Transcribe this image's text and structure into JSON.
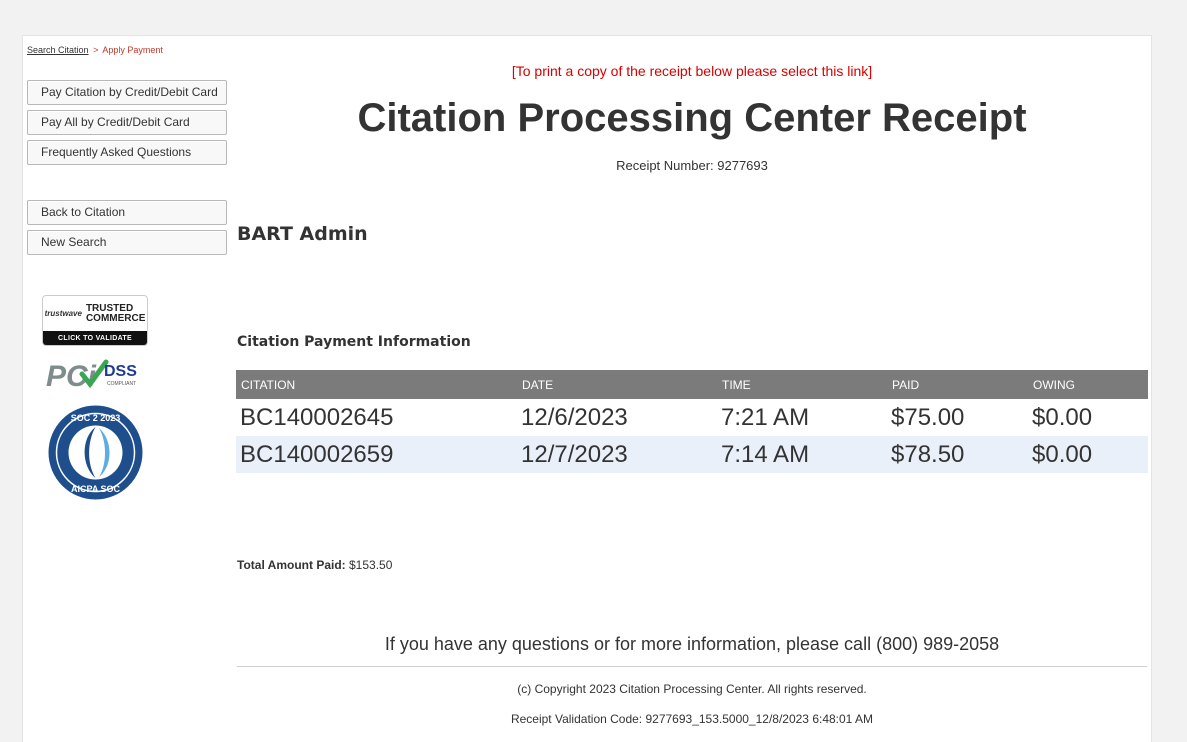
{
  "breadcrumb": {
    "link": "Search Citation",
    "separator": ">",
    "current": "Apply Payment"
  },
  "nav": {
    "pay_citation": "Pay Citation by Credit/Debit Card",
    "pay_all": "Pay All by Credit/Debit Card",
    "faq": "Frequently Asked Questions",
    "back": "Back to Citation",
    "new_search": "New Search"
  },
  "badges": {
    "trusted_logo": "trustwave",
    "trusted_line1": "TRUSTED",
    "trusted_line2": "COMMERCE",
    "trusted_click": "CLICK TO VALIDATE",
    "pci": "PCi",
    "dss": "DSS",
    "compliant": "COMPLIANT",
    "soc_top": "SOC 2 2023",
    "soc_bottom": "AICPA SOC"
  },
  "receipt": {
    "print_link": "[To print a copy of the receipt below please select this link]",
    "title": "Citation Processing Center Receipt",
    "number_label": "Receipt Number:",
    "number": "9277693",
    "account": "BART Admin",
    "section_title": "Citation Payment Information"
  },
  "table": {
    "headers": [
      "CITATION",
      "DATE",
      "TIME",
      "PAID",
      "OWING"
    ],
    "rows": [
      [
        "BC140002645",
        "12/6/2023",
        "7:21 AM",
        "$75.00",
        "$0.00"
      ],
      [
        "BC140002659",
        "12/7/2023",
        "7:14 AM",
        "$78.50",
        "$0.00"
      ]
    ]
  },
  "total": {
    "label": "Total Amount Paid:",
    "value": "$153.50"
  },
  "footer": {
    "contact": "If you have any questions or for more information, please call (800) 989-2058",
    "copyright": "(c) Copyright 2023 Citation Processing Center. All rights reserved.",
    "validation": "Receipt Validation Code: 9277693_153.5000_12/8/2023 6:48:01 AM"
  },
  "colors": {
    "link_red": "#d80000",
    "table_header": "#7b7b7b",
    "row_alt": "#eaf0fa",
    "soc_blue": "#1f4e8c"
  }
}
